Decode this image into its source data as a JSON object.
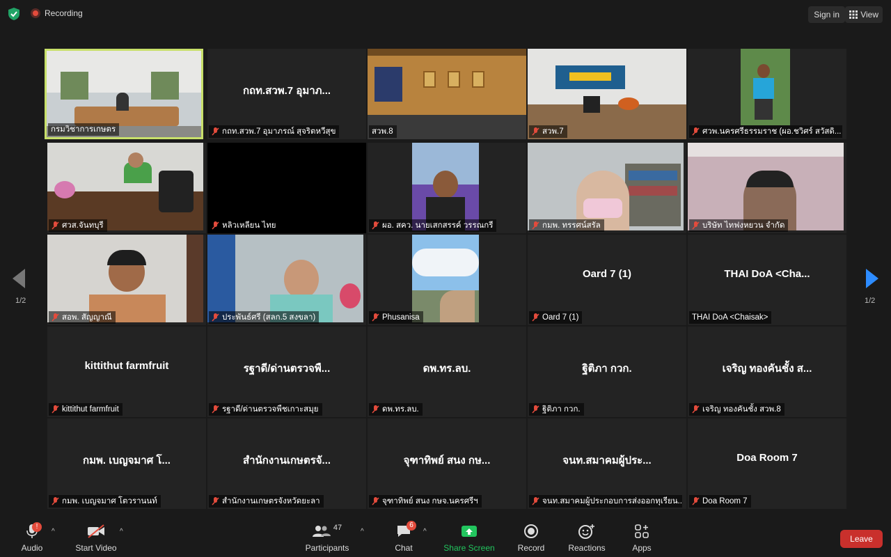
{
  "top": {
    "recording": "Recording",
    "signin": "Sign in",
    "view": "View"
  },
  "pager": {
    "left": "1/2",
    "right": "1/2"
  },
  "tiles": [
    {
      "big": "",
      "label": "กรมวิชาการเกษตร",
      "muted": false
    },
    {
      "big": "กถท.สวพ.7 อุมาภ...",
      "label": "กถท.สวพ.7 อุมาภรณ์ สุจริตหวีสุข",
      "muted": true
    },
    {
      "big": "",
      "label": "สวพ.8",
      "muted": false
    },
    {
      "big": "",
      "label": "สวพ.7",
      "muted": true
    },
    {
      "big": "",
      "label": "ศวพ.นครศรีธรรมราช (ผอ.ชวิศร์ สวัสดิ...",
      "muted": true
    },
    {
      "big": "",
      "label": "ศวส.จันทบุรี",
      "muted": true
    },
    {
      "big": "",
      "label": "หลิวเหลียน ไทย",
      "muted": true
    },
    {
      "big": "",
      "label": "ผอ. สคว. นายเสกสรรค์ วรรณกรี",
      "muted": true
    },
    {
      "big": "",
      "label": "กมพ. ทรรศน์สรัล",
      "muted": true
    },
    {
      "big": "",
      "label": "บริษัท ไทฟงหยวน จำกัด",
      "muted": true
    },
    {
      "big": "",
      "label": "สอพ. สัญญาณี",
      "muted": true
    },
    {
      "big": "",
      "label": "ประพันธ์ศรี (สลก.5 สงขลา)",
      "muted": true
    },
    {
      "big": "",
      "label": "Phusanisa",
      "muted": true
    },
    {
      "big": "Oard 7  (1)",
      "label": "Oard 7  (1)",
      "muted": true
    },
    {
      "big": "THAI DoA  <Cha...",
      "label": "THAI DoA <Chaisak>",
      "muted": false
    },
    {
      "big": "kittithut farmfruit",
      "label": "kittithut farmfruit",
      "muted": true
    },
    {
      "big": "รฐาดี/ด่านตรวจพื...",
      "label": "รฐาดี/ด่านตรวจพืชเกาะสมุย",
      "muted": true
    },
    {
      "big": "ดพ.ทร.ลบ.",
      "label": "ดพ.ทร.ลบ.",
      "muted": true
    },
    {
      "big": "ฐิติภา กวก.",
      "label": "ฐิติภา กวก.",
      "muted": true
    },
    {
      "big": "เจริญ ทองคันชั้ง ส...",
      "label": "เจริญ ทองคันชั้ง สวพ.8",
      "muted": true
    },
    {
      "big": "กมพ. เบญจมาศ โ...",
      "label": "กมพ. เบญจมาศ โตวรานนท์",
      "muted": true
    },
    {
      "big": "สำนักงานเกษตรจั...",
      "label": "สำนักงานเกษตรจังหวัดยะลา",
      "muted": true
    },
    {
      "big": "จุฑาทิพย์ สนง กษ...",
      "label": "จุฑาทิพย์ สนง กษจ.นครศรีฯ",
      "muted": true
    },
    {
      "big": "จนท.สมาคมผู้ประ...",
      "label": "จนท.สมาคมผู้ประกอบการส่งออกทุเรียน...",
      "muted": true
    },
    {
      "big": "Doa Room 7",
      "label": "Doa Room 7",
      "muted": true
    }
  ],
  "bottom": {
    "audio": "Audio",
    "audio_badge": "!",
    "video": "Start Video",
    "participants": "Participants",
    "participants_count": "47",
    "chat": "Chat",
    "chat_badge": "6",
    "share": "Share Screen",
    "record": "Recording",
    "reactions": "Reactions",
    "apps": "Apps",
    "leave": "Leave"
  },
  "colors": {
    "accent_green": "#22c55e",
    "leave_red": "#c9302c",
    "active_border": "#c8e06a"
  }
}
